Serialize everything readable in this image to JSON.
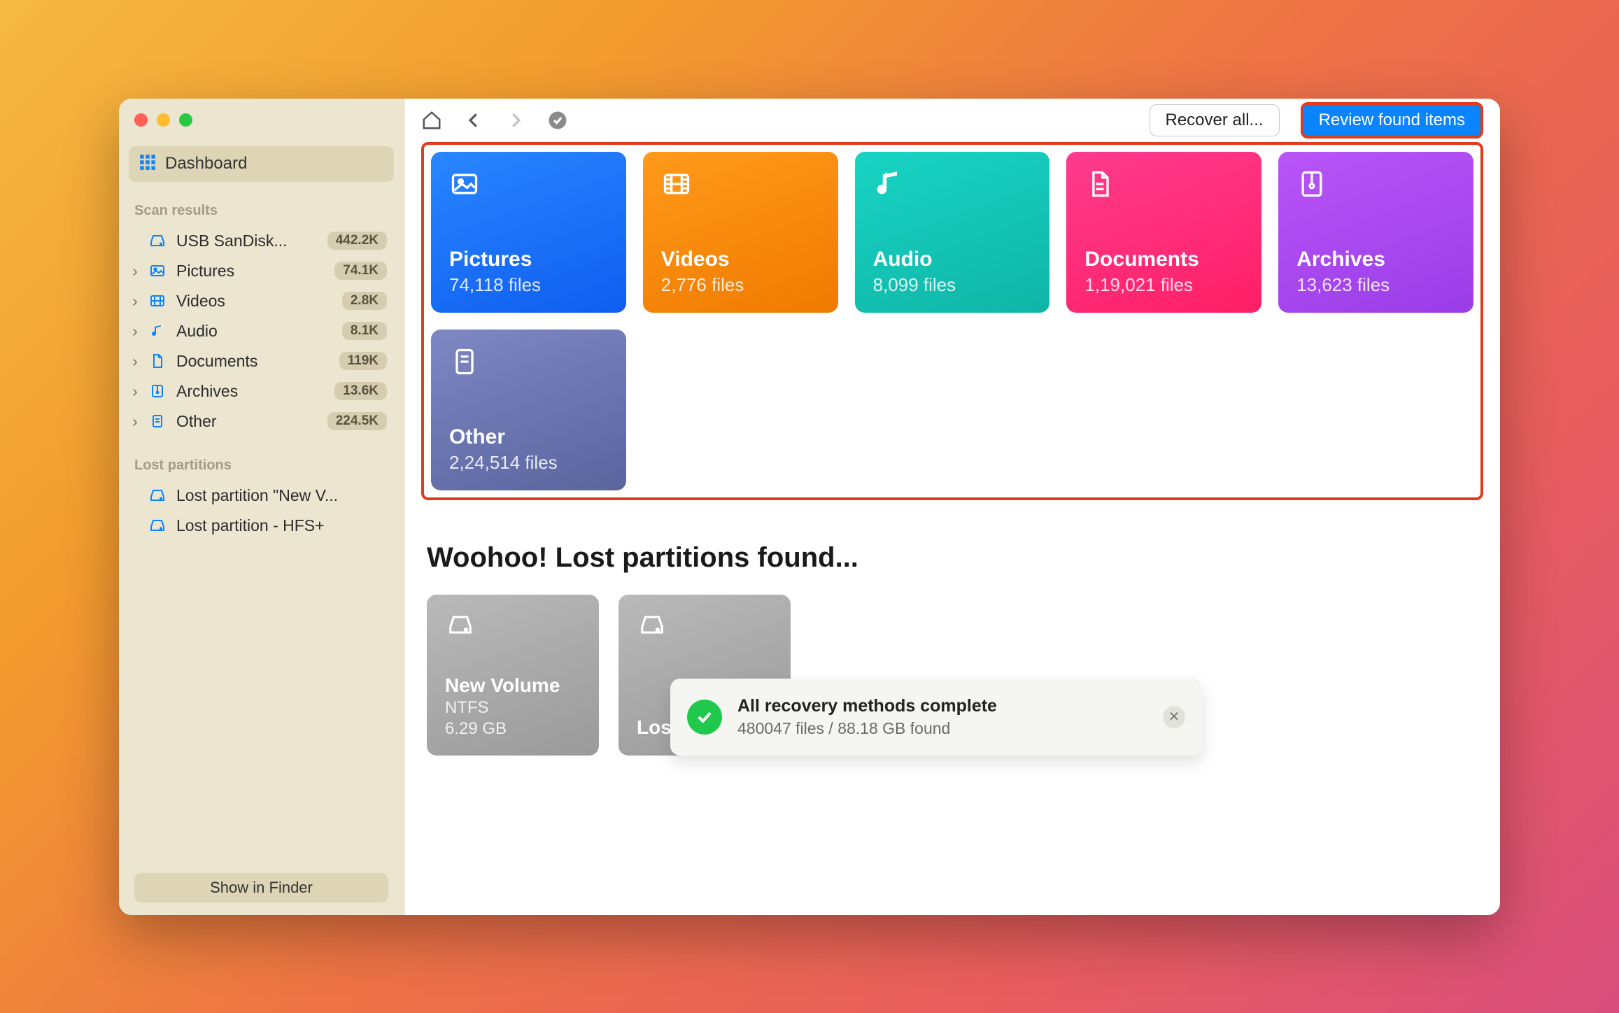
{
  "sidebar": {
    "dashboard_label": "Dashboard",
    "scan_results_label": "Scan results",
    "lost_partitions_label": "Lost partitions",
    "footer_button": "Show in Finder",
    "drive": {
      "label": "USB  SanDisk...",
      "badge": "442.2K"
    },
    "cats": [
      {
        "label": "Pictures",
        "badge": "74.1K"
      },
      {
        "label": "Videos",
        "badge": "2.8K"
      },
      {
        "label": "Audio",
        "badge": "8.1K"
      },
      {
        "label": "Documents",
        "badge": "119K"
      },
      {
        "label": "Archives",
        "badge": "13.6K"
      },
      {
        "label": "Other",
        "badge": "224.5K"
      }
    ],
    "lost": [
      {
        "label": "Lost partition \"New V..."
      },
      {
        "label": "Lost partition - HFS+"
      }
    ]
  },
  "toolbar": {
    "recover_all": "Recover all...",
    "review": "Review found items"
  },
  "cards": {
    "pictures": {
      "title": "Pictures",
      "sub": "74,118 files"
    },
    "videos": {
      "title": "Videos",
      "sub": "2,776 files"
    },
    "audio": {
      "title": "Audio",
      "sub": "8,099 files"
    },
    "documents": {
      "title": "Documents",
      "sub": "1,19,021 files"
    },
    "archives": {
      "title": "Archives",
      "sub": "13,623 files"
    },
    "other": {
      "title": "Other",
      "sub": "2,24,514 files"
    }
  },
  "lost_heading": "Woohoo! Lost partitions found...",
  "partitions": [
    {
      "title": "New Volume",
      "fs": "NTFS",
      "size": "6.29 GB"
    },
    {
      "title": "Lost partiti...",
      "fs": "",
      "size": ""
    }
  ],
  "toast": {
    "title": "All recovery methods complete",
    "sub": "480047 files / 88.18 GB found"
  }
}
